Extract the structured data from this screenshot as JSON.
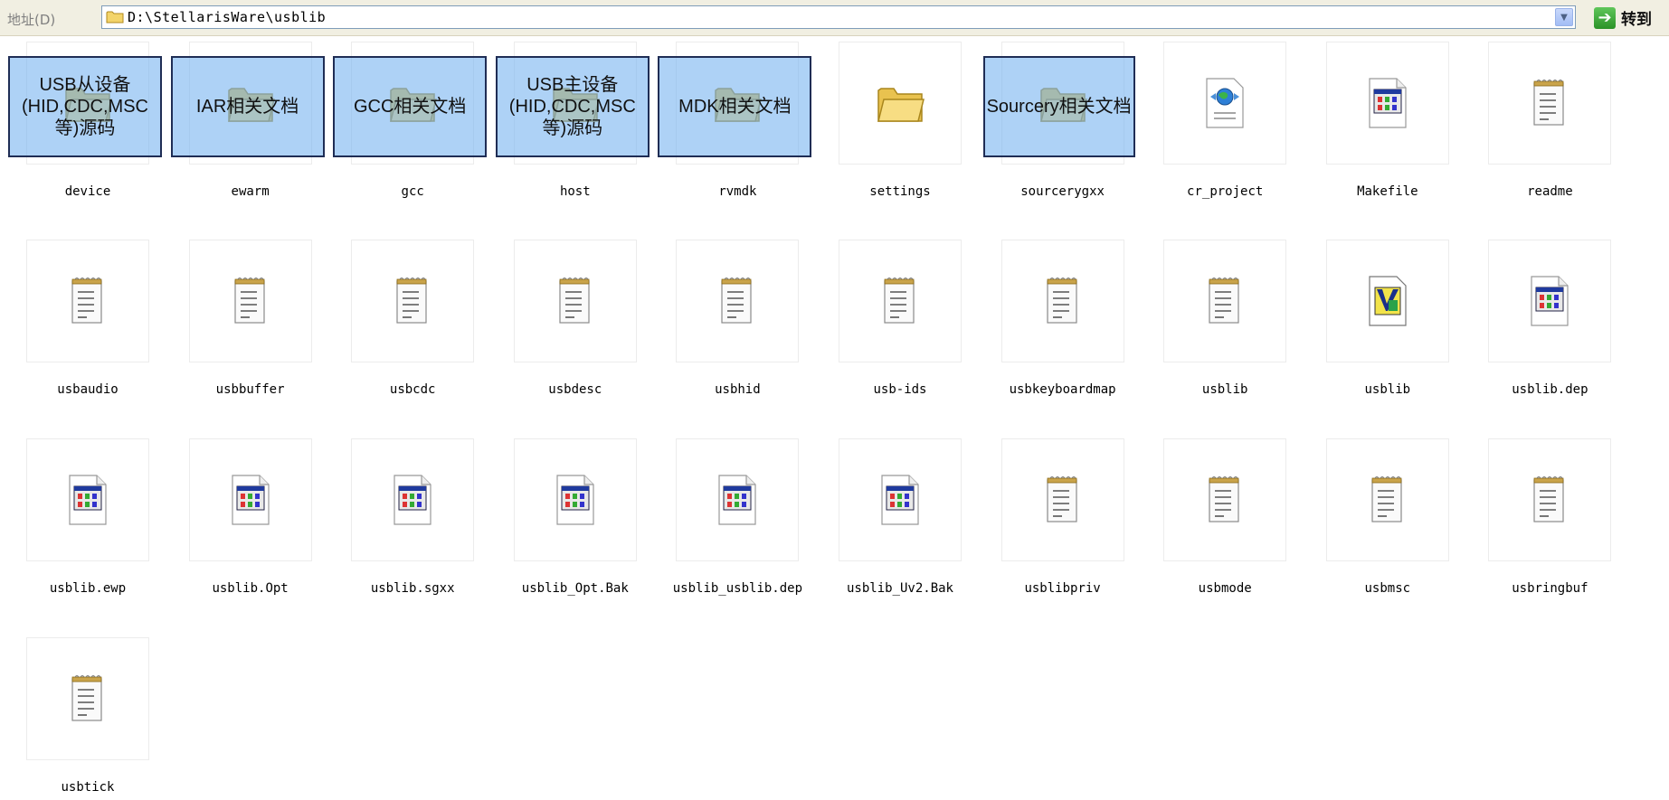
{
  "address_bar": {
    "label": "地址(D)",
    "path": "D:\\StellarisWare\\usblib",
    "go_label": "转到"
  },
  "files": [
    {
      "name": "device",
      "icon": "folder-icon"
    },
    {
      "name": "ewarm",
      "icon": "folder-icon"
    },
    {
      "name": "gcc",
      "icon": "folder-icon"
    },
    {
      "name": "host",
      "icon": "folder-icon"
    },
    {
      "name": "rvmdk",
      "icon": "folder-icon"
    },
    {
      "name": "settings",
      "icon": "folder-icon"
    },
    {
      "name": "sourcerygxx",
      "icon": "folder-icon"
    },
    {
      "name": "cr_project",
      "icon": "web-document-icon"
    },
    {
      "name": "Makefile",
      "icon": "window-document-icon"
    },
    {
      "name": "readme",
      "icon": "notepad-icon"
    },
    {
      "name": "usbaudio",
      "icon": "notepad-icon"
    },
    {
      "name": "usbbuffer",
      "icon": "notepad-icon"
    },
    {
      "name": "usbcdc",
      "icon": "notepad-icon"
    },
    {
      "name": "usbdesc",
      "icon": "notepad-icon"
    },
    {
      "name": "usbhid",
      "icon": "notepad-icon"
    },
    {
      "name": "usb-ids",
      "icon": "notepad-icon"
    },
    {
      "name": "usbkeyboardmap",
      "icon": "notepad-icon"
    },
    {
      "name": "usblib",
      "icon": "notepad-icon"
    },
    {
      "name": "usblib",
      "icon": "vision-project-icon"
    },
    {
      "name": "usblib.dep",
      "icon": "window-document-icon"
    },
    {
      "name": "usblib.ewp",
      "icon": "window-document-icon"
    },
    {
      "name": "usblib.Opt",
      "icon": "window-document-icon"
    },
    {
      "name": "usblib.sgxx",
      "icon": "window-document-icon"
    },
    {
      "name": "usblib_Opt.Bak",
      "icon": "window-document-icon"
    },
    {
      "name": "usblib_usblib.dep",
      "icon": "window-document-icon"
    },
    {
      "name": "usblib_Uv2.Bak",
      "icon": "window-document-icon"
    },
    {
      "name": "usblibpriv",
      "icon": "notepad-icon"
    },
    {
      "name": "usbmode",
      "icon": "notepad-icon"
    },
    {
      "name": "usbmsc",
      "icon": "notepad-icon"
    },
    {
      "name": "usbringbuf",
      "icon": "notepad-icon"
    },
    {
      "name": "usbtick",
      "icon": "notepad-icon"
    }
  ],
  "callouts": [
    {
      "text": "USB从设备(HID,CDC,MSC等)源码",
      "target": "device"
    },
    {
      "text": "IAR相关文档",
      "target": "ewarm"
    },
    {
      "text": "GCC相关文档",
      "target": "gcc"
    },
    {
      "text": "USB主设备(HID,CDC,MSC等)源码",
      "target": "host"
    },
    {
      "text": "MDK相关文档",
      "target": "rvmdk"
    },
    {
      "text": "Sourcery相关文档",
      "target": "sourcerygxx"
    }
  ],
  "colors": {
    "callout_fill": "#7ab4f0",
    "callout_border": "#1f2d55",
    "folder": "#f3d46a"
  }
}
